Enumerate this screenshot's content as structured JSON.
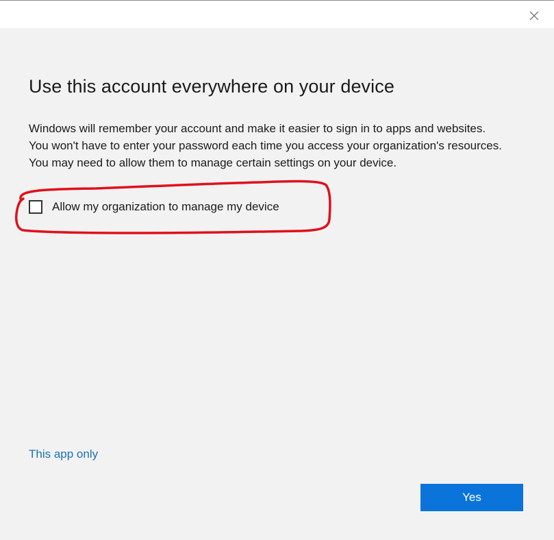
{
  "dialog": {
    "close_icon": "close-icon",
    "heading": "Use this account everywhere on your device",
    "description": "Windows will remember your account and make it easier to sign in to apps and websites. You won't have to enter your password each time you access your organization's resources. You may need to allow them to manage certain settings on your device.",
    "checkbox": {
      "label": "Allow my organization to manage my device",
      "checked": false
    },
    "link_label": "This app only",
    "primary_button_label": "Yes"
  },
  "colors": {
    "background": "#f2f2f2",
    "titlebar": "#ffffff",
    "accent": "#0a74da",
    "link": "#1a70b8",
    "annotation": "#e0101c"
  }
}
